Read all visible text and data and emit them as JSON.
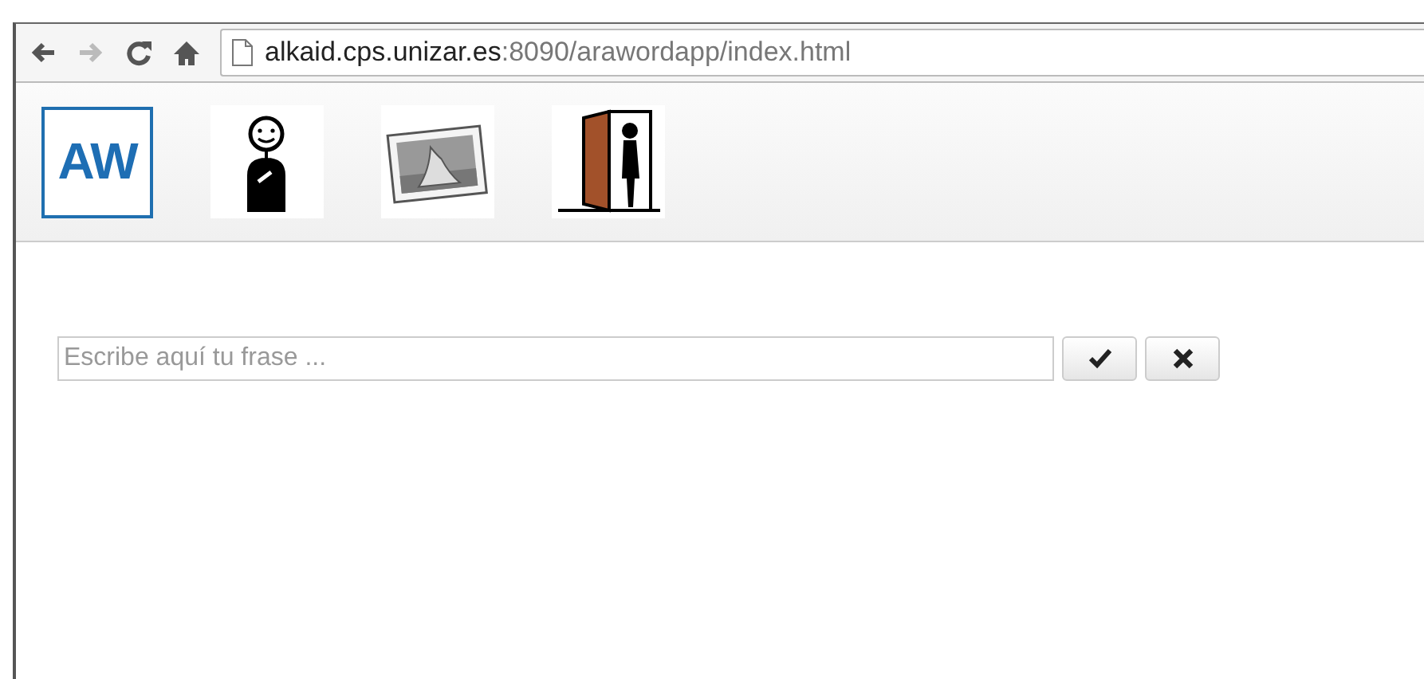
{
  "browser": {
    "nav": [
      {
        "kind": "back",
        "disabled": false
      },
      {
        "kind": "forward",
        "disabled": true
      },
      {
        "kind": "reload",
        "disabled": false
      },
      {
        "kind": "home",
        "disabled": false
      }
    ],
    "address": {
      "host": "alkaid.cps.unizar.es",
      "rest": ":8090/arawordapp/index.html"
    }
  },
  "toolbar": {
    "logo": "AW",
    "items": [
      {
        "kind": "person"
      },
      {
        "kind": "photo"
      },
      {
        "kind": "door"
      }
    ]
  },
  "phrase": {
    "placeholder": "Escribe aquí tu frase ...",
    "buttons": [
      {
        "kind": "check"
      },
      {
        "kind": "cross"
      }
    ]
  }
}
